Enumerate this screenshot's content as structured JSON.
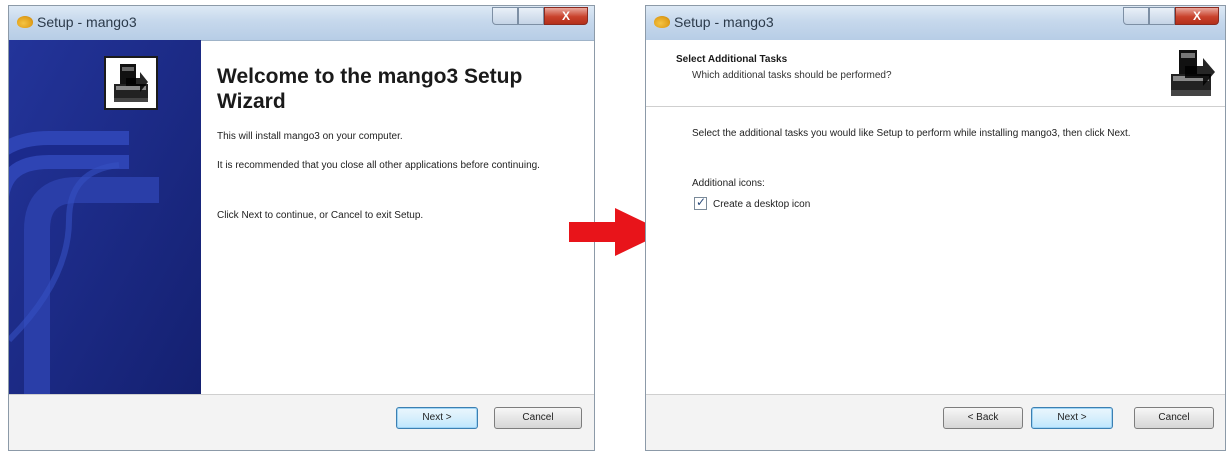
{
  "left_window": {
    "title": "Setup - mango3",
    "close_label": "X",
    "heading": "Welcome to the mango3 Setup Wizard",
    "paragraphs": [
      "This will install mango3 on your computer.",
      "It is recommended that you close all other applications before continuing.",
      "Click Next to continue, or Cancel to exit Setup."
    ],
    "buttons": {
      "next": "Next >",
      "cancel": "Cancel"
    }
  },
  "right_window": {
    "title": "Setup - mango3",
    "close_label": "X",
    "header_title": "Select Additional Tasks",
    "header_subtitle": "Which additional tasks should be performed?",
    "instruction": "Select the additional tasks you would like Setup to perform while installing mango3, then click Next.",
    "group_label": "Additional icons:",
    "checkbox_label": "Create a desktop icon",
    "checkbox_checked": true,
    "buttons": {
      "back": "< Back",
      "next": "Next >",
      "cancel": "Cancel"
    }
  },
  "colors": {
    "side_panel": "#1a2a86",
    "arrow": "#e8141a",
    "default_button_border": "#3c7fb1"
  }
}
